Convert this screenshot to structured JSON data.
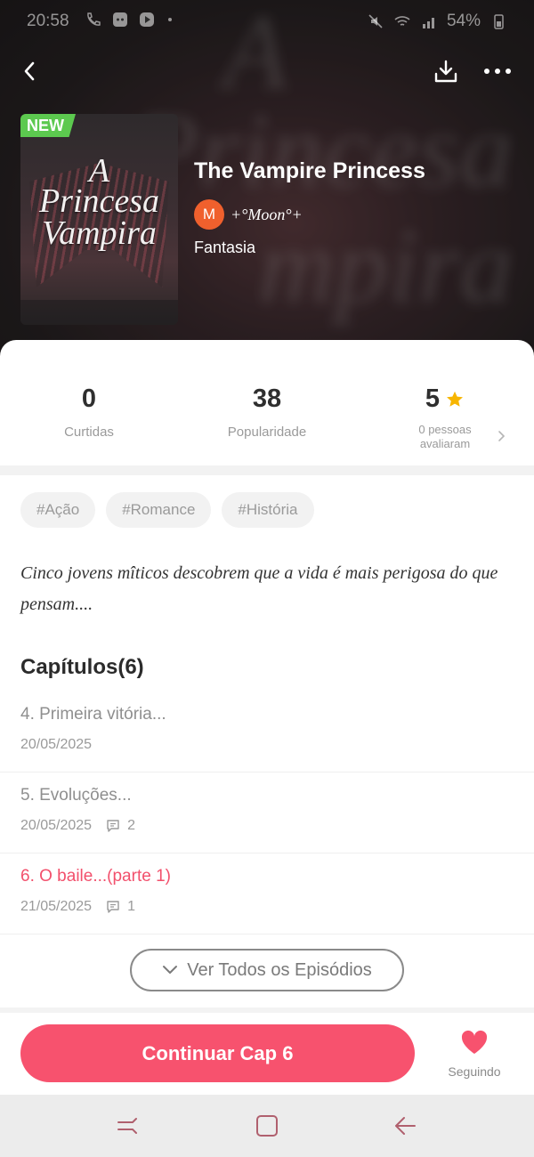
{
  "status_bar": {
    "time": "20:58",
    "battery": "54%"
  },
  "book": {
    "badge": "NEW",
    "cover_lines": [
      "A",
      "Princesa",
      "Vampira"
    ],
    "title": "The Vampire Princess",
    "author_initial": "M",
    "author_name": "+°Moon°+",
    "genre": "Fantasia",
    "synopsis": "Cinco jovens mîticos descobrem que a vida é mais perigosa do que pensam...."
  },
  "stats": {
    "likes_value": "0",
    "likes_label": "Curtidas",
    "popularity_value": "38",
    "popularity_label": "Popularidade",
    "rating_value": "5",
    "rating_label_1": "0 pessoas",
    "rating_label_2": "avaliaram"
  },
  "tags": [
    "#Ação",
    "#Romance",
    "#História"
  ],
  "chapters": {
    "heading": "Capítulos(6)",
    "items": [
      {
        "title": "4. Primeira vitória...",
        "date": "20/05/2025",
        "comments": ""
      },
      {
        "title": "5. Evoluções...",
        "date": "20/05/2025",
        "comments": "2"
      },
      {
        "title": "6. O baile...(parte 1)",
        "date": "21/05/2025",
        "comments": "1"
      }
    ],
    "see_all_label": "Ver Todos os Episódios"
  },
  "actions": {
    "continue_label": "Continuar Cap 6",
    "follow_label": "Seguindo"
  },
  "colors": {
    "accent": "#f7526e",
    "badge_green": "#5cc94f",
    "avatar_orange": "#f0602d",
    "star": "#f7b500"
  },
  "icons": {
    "back": "back-arrow-icon",
    "download": "download-icon",
    "more": "more-dots-icon",
    "star": "star-icon",
    "chevron": "chevron-right-icon",
    "comment": "comment-icon",
    "heart": "heart-icon"
  }
}
